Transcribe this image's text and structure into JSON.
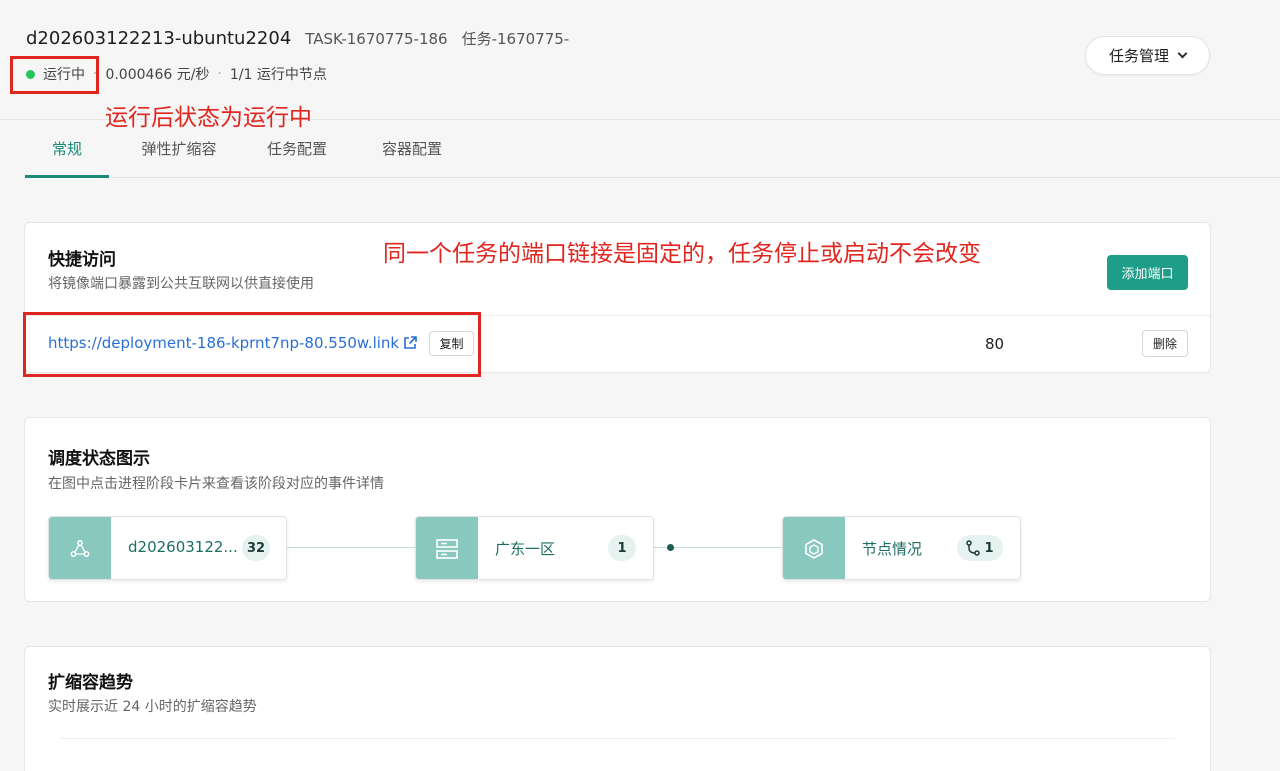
{
  "header": {
    "task_name": "d202603122213-ubuntu2204",
    "task_id": "TASK-1670775-186",
    "task_cn": "任务-1670775-",
    "status": "运行中",
    "price": "0.000466 元/秒",
    "nodes": "1/1 运行中节点",
    "separator": "·",
    "status_color": "#22c55e",
    "manage_button": "任务管理"
  },
  "annotations": {
    "status_note": "运行后状态为运行中",
    "link_note": "同一个任务的端口链接是固定的，任务停止或启动不会改变",
    "color": "#e0261f"
  },
  "tabs": [
    {
      "label": "常规",
      "active": true
    },
    {
      "label": "弹性扩缩容",
      "active": false
    },
    {
      "label": "任务配置",
      "active": false
    },
    {
      "label": "容器配置",
      "active": false
    }
  ],
  "quick_access": {
    "title": "快捷访问",
    "subtitle": "将镜像端口暴露到公共互联网以供直接使用",
    "add_button": "添加端口",
    "port_link": "https://deployment-186-kprnt7np-80.550w.link",
    "copy_button": "复制",
    "port": "80",
    "delete_button": "删除",
    "accent": "#1e9e88"
  },
  "schedule": {
    "title": "调度状态图示",
    "subtitle": "在图中点击进程阶段卡片来查看该阶段对应的事件详情",
    "nodes": [
      {
        "label": "d202603122...",
        "count": "32",
        "icon": "deployment-icon"
      },
      {
        "label": "广东一区",
        "count": "1",
        "icon": "server-icon"
      },
      {
        "label": "节点情况",
        "count": "1",
        "icon": "cube-icon",
        "badge_icon": "branch-icon"
      }
    ]
  },
  "trend": {
    "title": "扩缩容趋势",
    "subtitle": "实时展示近 24 小时的扩缩容趋势"
  }
}
